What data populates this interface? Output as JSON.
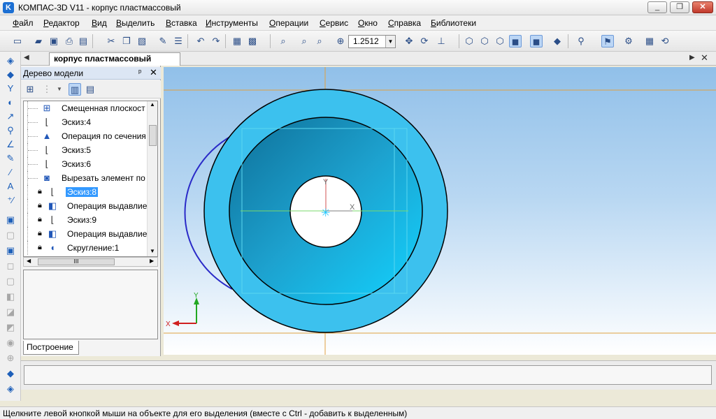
{
  "window": {
    "title": "КОМПАС-3D V11 - корпус пластмассовый",
    "app_icon_letter": "K",
    "minimize": "_",
    "maximize": "❐",
    "close": "✕"
  },
  "menu": [
    "Файл",
    "Редактор",
    "Вид",
    "Выделить",
    "Вставка",
    "Инструменты",
    "Операции",
    "Сервис",
    "Окно",
    "Справка",
    "Библиотеки"
  ],
  "toolbar": {
    "zoom_value": "1.2512"
  },
  "document_tab": {
    "label": "корпус пластмассовый"
  },
  "model_tree": {
    "title": "Дерево модели",
    "pin": "ᵖ",
    "close": "✕",
    "items": [
      {
        "label": "Смещенная плоскост",
        "icon": "offset-plane-icon",
        "locked": false,
        "selected": false
      },
      {
        "label": "Эскиз:4",
        "icon": "sketch-icon",
        "locked": false,
        "selected": false
      },
      {
        "label": "Операция по сечения",
        "icon": "loft-operation-icon",
        "locked": false,
        "selected": false
      },
      {
        "label": "Эскиз:5",
        "icon": "sketch-icon",
        "locked": false,
        "selected": false
      },
      {
        "label": "Эскиз:6",
        "icon": "sketch-icon",
        "locked": false,
        "selected": false
      },
      {
        "label": "Вырезать элемент по",
        "icon": "cut-operation-icon",
        "locked": false,
        "selected": false
      },
      {
        "label": "Эскиз:8",
        "icon": "sketch-icon",
        "locked": true,
        "selected": true
      },
      {
        "label": "Операция выдавлие",
        "icon": "extrude-operation-icon",
        "locked": true,
        "selected": false
      },
      {
        "label": "Эскиз:9",
        "icon": "sketch-icon",
        "locked": true,
        "selected": false
      },
      {
        "label": "Операция выдавлие",
        "icon": "extrude-operation-icon",
        "locked": true,
        "selected": false
      },
      {
        "label": "Скругление:1",
        "icon": "fillet-icon",
        "locked": true,
        "selected": false
      }
    ],
    "hscroll_grip": "III",
    "bottom_tab": "Построение"
  },
  "viewport": {
    "axis_labels": {
      "x": "X",
      "y": "Y",
      "corner_x": "X",
      "corner_y": "Y"
    },
    "colors": {
      "body": "#3cc1ee",
      "inner": "#1f8fbd",
      "bore_edge": "#000000",
      "sketch": "#2a2ac8",
      "axis_x": "#3aa03a",
      "axis_y": "#d02020",
      "guide": "#e0a040"
    }
  },
  "status_bar": {
    "message": "Щелкните левой кнопкой мыши на объекте для его выделения (вместе с Ctrl - добавить к выделенным)"
  }
}
